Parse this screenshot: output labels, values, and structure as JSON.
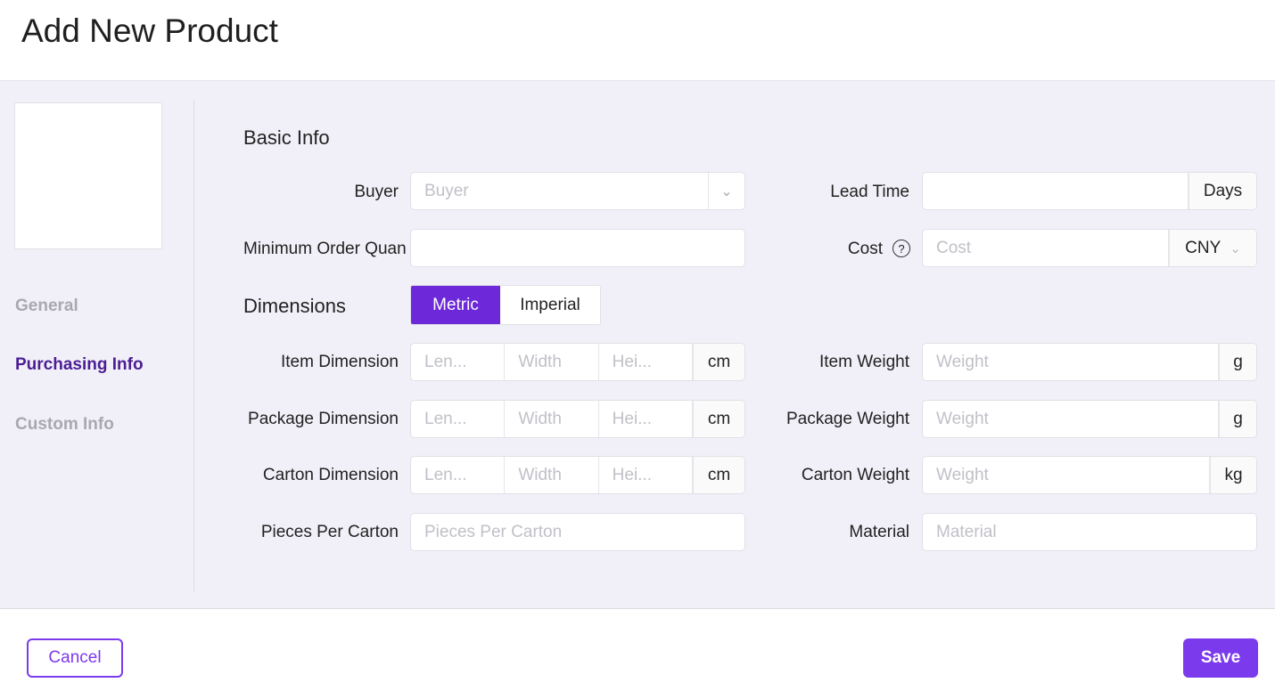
{
  "title": "Add New Product",
  "nav": [
    "General",
    "Purchasing Info",
    "Custom Info"
  ],
  "sections": {
    "basic": "Basic Info",
    "dimensions": "Dimensions"
  },
  "unit_toggle": {
    "options": [
      "Metric",
      "Imperial"
    ],
    "selected": "Metric"
  },
  "fields": {
    "buyer": {
      "label": "Buyer",
      "placeholder": "Buyer"
    },
    "moq": {
      "label": "Minimum Order Quan",
      "value": ""
    },
    "lead_time": {
      "label": "Lead Time",
      "value": "",
      "addon": "Days"
    },
    "cost": {
      "label": "Cost",
      "placeholder": "Cost",
      "currency": "CNY"
    },
    "item_dim": {
      "label": "Item Dimension",
      "placeholders": [
        "Len...",
        "Width",
        "Hei..."
      ],
      "unit": "cm"
    },
    "package_dim": {
      "label": "Package Dimension",
      "placeholders": [
        "Len...",
        "Width",
        "Hei..."
      ],
      "unit": "cm"
    },
    "carton_dim": {
      "label": "Carton Dimension",
      "placeholders": [
        "Len...",
        "Width",
        "Hei..."
      ],
      "unit": "cm"
    },
    "item_weight": {
      "label": "Item Weight",
      "placeholder": "Weight",
      "unit": "g"
    },
    "package_weight": {
      "label": "Package Weight",
      "placeholder": "Weight",
      "unit": "g"
    },
    "carton_weight": {
      "label": "Carton Weight",
      "placeholder": "Weight",
      "unit": "kg"
    },
    "pieces": {
      "label": "Pieces Per Carton",
      "placeholder": "Pieces Per Carton"
    },
    "material": {
      "label": "Material",
      "placeholder": "Material"
    }
  },
  "footer": {
    "cancel": "Cancel",
    "save": "Save"
  },
  "colors": {
    "accent": "#7c3aed",
    "nav_active": "#4c1d95",
    "panel_bg": "#f1f0f8"
  }
}
